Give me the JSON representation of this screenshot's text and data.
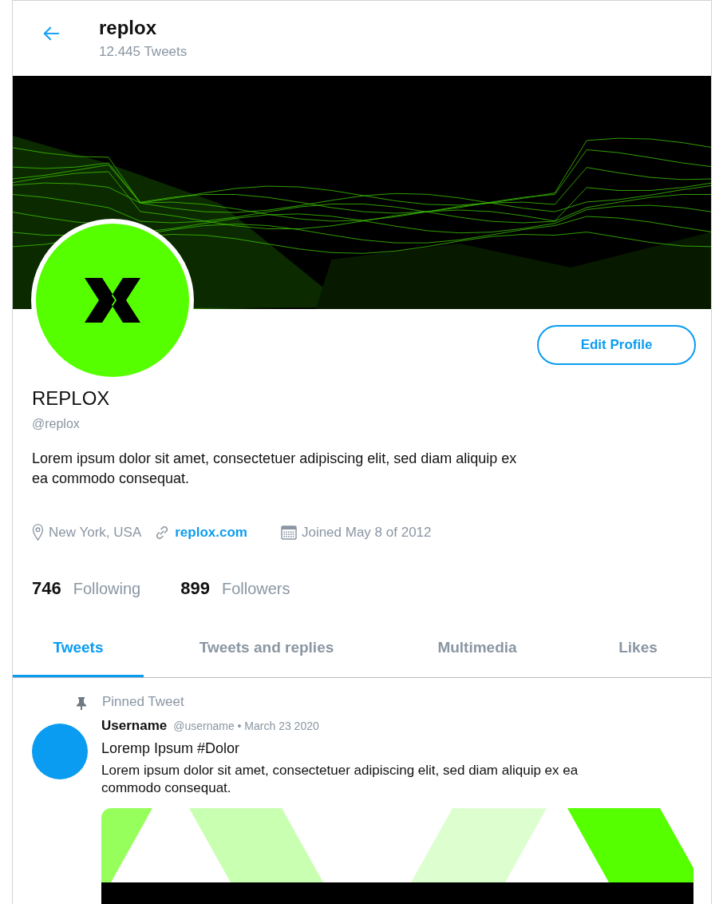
{
  "header": {
    "title": "replox",
    "subtitle": "12.445 Tweets"
  },
  "profile": {
    "name": "REPLOX",
    "handle": "@replox",
    "bio": "Lorem ipsum dolor sit amet, consectetuer adipiscing elit, sed diam aliquip ex ea commodo consequat.",
    "edit_button": "Edit Profile",
    "location": "New York, USA",
    "website": "replox.com",
    "joined": "Joined May 8 of 2012"
  },
  "stats": [
    {
      "count": "746",
      "label": "Following"
    },
    {
      "count": "899",
      "label": "Followers"
    }
  ],
  "tabs": [
    {
      "label": "Tweets",
      "selected": true
    },
    {
      "label": "Tweets and replies",
      "selected": false
    },
    {
      "label": "Multimedia",
      "selected": false
    },
    {
      "label": "Likes",
      "selected": false
    }
  ],
  "pinned_tweet": {
    "label": "Pinned Tweet",
    "author": "Username",
    "meta": "@username • March 23 2020",
    "title": "Loremp Ipsum #Dolor",
    "text": "Lorem ipsum dolor sit amet, consectetuer adipiscing elit, sed diam aliquip ex ea commodo consequat."
  }
}
